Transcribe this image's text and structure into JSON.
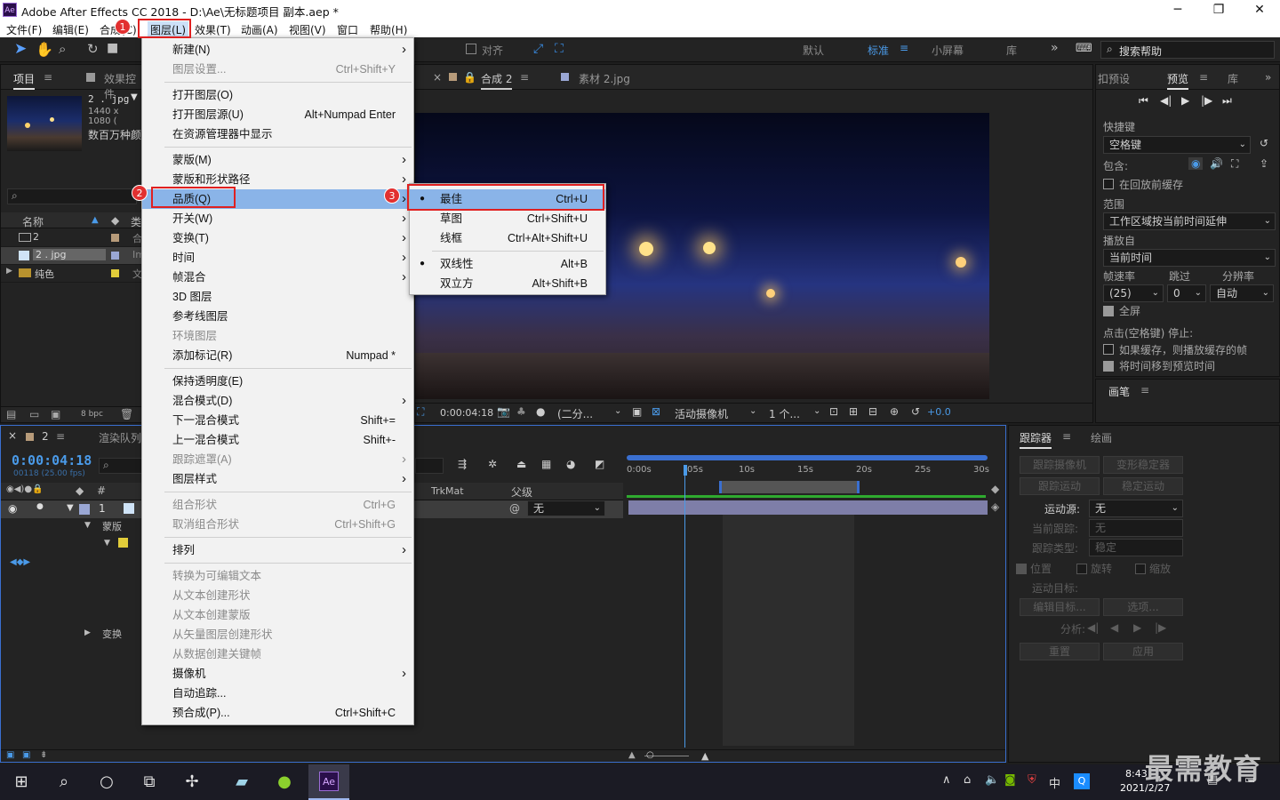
{
  "window": {
    "title": "Adobe After Effects CC 2018 - D:\\Ae\\无标题项目 副本.aep *",
    "app_badge": "Ae"
  },
  "menubar": [
    "文件(F)",
    "编辑(E)",
    "合成(C)",
    "图层(L)",
    "效果(T)",
    "动画(A)",
    "视图(V)",
    "窗口",
    "帮助(H)"
  ],
  "toolbar": {
    "snap_label": "对齐",
    "workspaces": [
      "默认",
      "标准",
      "小屏幕",
      "库"
    ],
    "search_help": "搜索帮助"
  },
  "project_panel": {
    "tabs": [
      "项目",
      "效果控件"
    ],
    "file_name": "2 . jpg",
    "file_info": "1440 x 1080 (",
    "file_info2": "数百万种颜",
    "columns": [
      "名称",
      "类"
    ],
    "items": [
      {
        "name": "2",
        "type": "合"
      },
      {
        "name": "2 . jpg",
        "type": "Im"
      },
      {
        "name": "纯色",
        "type": "文"
      }
    ],
    "bpc": "8 bpc"
  },
  "comp_panel": {
    "tabs": [
      "合成 2",
      "素材 2.jpg"
    ],
    "timecode": "0:00:04:18",
    "resolution": "(二分...",
    "camera": "活动摄像机",
    "views": "1 个...",
    "exposure": "+0.0"
  },
  "preview_panel": {
    "tabs": [
      "扣预设",
      "预览",
      "库"
    ],
    "shortcut_label": "快捷键",
    "shortcut_value": "空格键",
    "include_label": "包含:",
    "cache_before": "在回放前缓存",
    "range_label": "范围",
    "range_value": "工作区域按当前时间延伸",
    "play_from_label": "播放自",
    "play_from_value": "当前时间",
    "fps_label": "帧速率",
    "skip_label": "跳过",
    "res_label": "分辨率",
    "fps_value": "(25)",
    "skip_value": "0",
    "res_value": "自动",
    "fullscreen": "全屏",
    "stop_label": "点击(空格键) 停止:",
    "opt_cache": "如果缓存，则播放缓存的帧",
    "opt_move_time": "将时间移到预览时间",
    "brush_tab": "画笔"
  },
  "tracker_panel": {
    "tabs": [
      "跟踪器",
      "绘画"
    ],
    "btn_track_camera": "跟踪摄像机",
    "btn_warp": "变形稳定器",
    "btn_track_motion": "跟踪运动",
    "btn_stabilize": "稳定运动",
    "motion_source_label": "运动源:",
    "motion_source_value": "无",
    "current_track_label": "当前跟踪:",
    "current_track_value": "无",
    "track_type_label": "跟踪类型:",
    "track_type_value": "稳定",
    "cb_position": "位置",
    "cb_rotation": "旋转",
    "cb_scale": "缩放",
    "motion_target_label": "运动目标:",
    "btn_edit_target": "编辑目标...",
    "btn_options": "选项...",
    "analyze_label": "分析:",
    "btn_reset": "重置",
    "btn_apply": "应用"
  },
  "timeline": {
    "tab": "2",
    "render_queue": "渲染队列",
    "timecode": "0:00:04:18",
    "frames": "00118 (25.00 fps)",
    "layer_num": "1",
    "mask_label": "蒙版",
    "transform_label": "变换",
    "col_trkmat": "TrkMat",
    "col_parent": "父级",
    "parent_value": "无",
    "ruler": [
      "0:00s",
      "05s",
      "10s",
      "15s",
      "20s",
      "25s",
      "30s"
    ]
  },
  "layer_menu": [
    {
      "label": "新建(N)",
      "arrow": true
    },
    {
      "label": "图层设置...",
      "shortcut": "Ctrl+Shift+Y",
      "disabled": true
    },
    {
      "sep": true
    },
    {
      "label": "打开图层(O)"
    },
    {
      "label": "打开图层源(U)",
      "shortcut": "Alt+Numpad Enter"
    },
    {
      "label": "在资源管理器中显示"
    },
    {
      "sep": true
    },
    {
      "label": "蒙版(M)",
      "arrow": true
    },
    {
      "label": "蒙版和形状路径",
      "arrow": true
    },
    {
      "label": "品质(Q)",
      "arrow": true,
      "highlight": true
    },
    {
      "label": "开关(W)",
      "arrow": true
    },
    {
      "label": "变换(T)",
      "arrow": true
    },
    {
      "label": "时间",
      "arrow": true
    },
    {
      "label": "帧混合",
      "arrow": true
    },
    {
      "label": "3D 图层"
    },
    {
      "label": "参考线图层"
    },
    {
      "label": "环境图层",
      "disabled": true
    },
    {
      "label": "添加标记(R)",
      "shortcut": "Numpad *"
    },
    {
      "sep": true
    },
    {
      "label": "保持透明度(E)"
    },
    {
      "label": "混合模式(D)",
      "arrow": true
    },
    {
      "label": "下一混合模式",
      "shortcut": "Shift+="
    },
    {
      "label": "上一混合模式",
      "shortcut": "Shift+-"
    },
    {
      "label": "跟踪遮罩(A)",
      "arrow": true,
      "disabled": true
    },
    {
      "label": "图层样式",
      "arrow": true
    },
    {
      "sep": true
    },
    {
      "label": "组合形状",
      "shortcut": "Ctrl+G",
      "disabled": true
    },
    {
      "label": "取消组合形状",
      "shortcut": "Ctrl+Shift+G",
      "disabled": true
    },
    {
      "sep": true
    },
    {
      "label": "排列",
      "arrow": true
    },
    {
      "sep": true
    },
    {
      "label": "转换为可编辑文本",
      "disabled": true
    },
    {
      "label": "从文本创建形状",
      "disabled": true
    },
    {
      "label": "从文本创建蒙版",
      "disabled": true
    },
    {
      "label": "从矢量图层创建形状",
      "disabled": true
    },
    {
      "label": "从数据创建关键帧",
      "disabled": true
    },
    {
      "label": "摄像机",
      "arrow": true
    },
    {
      "label": "自动追踪..."
    },
    {
      "label": "预合成(P)...",
      "shortcut": "Ctrl+Shift+C"
    }
  ],
  "quality_submenu": [
    {
      "label": "最佳",
      "shortcut": "Ctrl+U",
      "checked": true,
      "highlight": true
    },
    {
      "label": "草图",
      "shortcut": "Ctrl+Shift+U"
    },
    {
      "label": "线框",
      "shortcut": "Ctrl+Alt+Shift+U"
    },
    {
      "sep": true
    },
    {
      "label": "双线性",
      "shortcut": "Alt+B",
      "checked": true
    },
    {
      "label": "双立方",
      "shortcut": "Alt+Shift+B"
    }
  ],
  "annotations": [
    "1",
    "2",
    "3"
  ],
  "taskbar": {
    "time": "8:43",
    "date": "2021/2/27",
    "ime": "中",
    "watermark": "最需教育"
  }
}
